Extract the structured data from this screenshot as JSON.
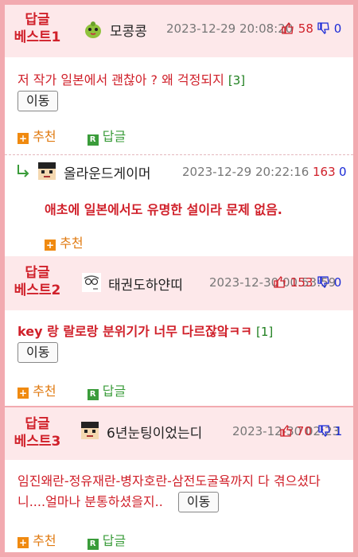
{
  "labels": {
    "recommend": "추천",
    "reply": "답글",
    "move": "이동"
  },
  "best1": {
    "tag_line1": "답글",
    "tag_line2": "베스트1",
    "nick": "모콩콩",
    "date": "2023-12-29 20:08:20",
    "up": "58",
    "down": "0",
    "text": "저 작가 일본에서 괜찮아 ? 왜 걱정되지",
    "replies": "[3]"
  },
  "reply1": {
    "nick": "올라운드게이머",
    "date": "2023-12-29 20:22:16",
    "up": "163",
    "down": "0",
    "text": "애초에 일본에서도 유명한 설이라 문제 없음."
  },
  "best2": {
    "tag_line1": "답글",
    "tag_line2": "베스트2",
    "nick": "태권도하얀띠",
    "date": "2023-12-30 00:53:59",
    "up": "153",
    "down": "0",
    "text": "key 랑 랄로랑 분위기가 너무 다르잖앜ㅋㅋ",
    "replies": "[1]"
  },
  "best3": {
    "tag_line1": "답글",
    "tag_line2": "베스트3",
    "nick": "6년눈팅이었는디",
    "date": "2023-12-30 02:23",
    "up": "70",
    "down": "1",
    "text": "임진왜란-정유재란-병자호란-삼전도굴욕까지 다 겪으셨다니....얼마나 분통하셨을지.."
  },
  "icons": {
    "thumb_up": "thumbs-up-icon",
    "thumb_down": "thumbs-down-icon",
    "reply_arrow": "reply-arrow-icon"
  },
  "colors": {
    "best_red": "#d0202a",
    "down_blue": "#1a2ad6",
    "reply_green": "#3a9c3a",
    "recommend_orange": "#e07a10",
    "border_pink": "#f2aab0"
  }
}
